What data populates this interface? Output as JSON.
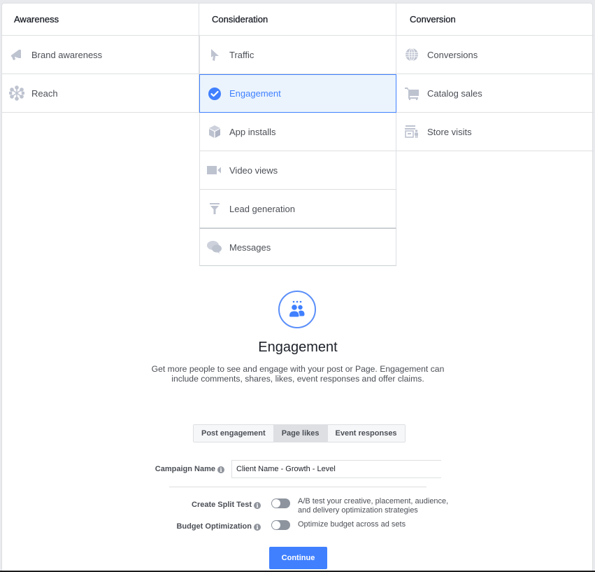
{
  "columns": [
    {
      "title": "Awareness",
      "items": [
        {
          "label": "Brand awareness",
          "icon": "megaphone-icon"
        },
        {
          "label": "Reach",
          "icon": "reach-icon"
        }
      ]
    },
    {
      "title": "Consideration",
      "items": [
        {
          "label": "Traffic",
          "icon": "cursor-icon"
        },
        {
          "label": "Engagement",
          "icon": "check-circle-icon",
          "selected": true
        },
        {
          "label": "App installs",
          "icon": "box-icon"
        },
        {
          "label": "Video views",
          "icon": "video-camera-icon"
        },
        {
          "label": "Lead generation",
          "icon": "funnel-icon"
        },
        {
          "label": "Messages",
          "icon": "chat-bubbles-icon"
        }
      ]
    },
    {
      "title": "Conversion",
      "items": [
        {
          "label": "Conversions",
          "icon": "globe-icon"
        },
        {
          "label": "Catalog sales",
          "icon": "cart-icon"
        },
        {
          "label": "Store visits",
          "icon": "store-icon"
        }
      ]
    }
  ],
  "detail": {
    "icon": "people-engagement-icon",
    "title": "Engagement",
    "description": "Get more people to see and engage with your post or Page. Engagement can include comments, shares, likes, event responses and offer claims."
  },
  "engagement_types": {
    "options": [
      "Post engagement",
      "Page likes",
      "Event responses"
    ],
    "selected": "Page likes"
  },
  "form": {
    "campaign_name_label": "Campaign Name",
    "campaign_name_value": "Client Name - Growth - Level",
    "split_test_label": "Create Split Test",
    "split_test_on": false,
    "split_test_desc_line1": "A/B test your creative, placement, audience,",
    "split_test_desc_line2": "and delivery optimization strategies",
    "budget_label": "Budget Optimization",
    "budget_on": false,
    "budget_desc": "Optimize budget across ad sets",
    "info_glyph": "i",
    "continue_label": "Continue"
  },
  "colors": {
    "accent": "#4080ff",
    "selected_bg": "#ebf4fd",
    "icon_muted": "#bec3d0"
  }
}
